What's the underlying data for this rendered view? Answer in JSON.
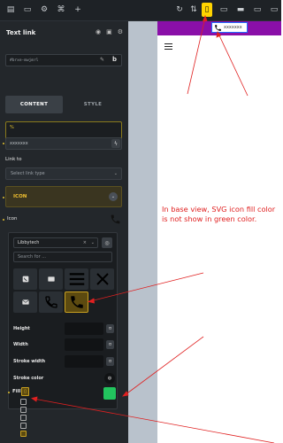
{
  "panel": {
    "title": "Text link",
    "id_field": "#brxe-mwjmrl",
    "tabs": [
      {
        "label": "CONTENT",
        "active": true
      },
      {
        "label": "STYLE",
        "active": false
      }
    ],
    "code_value": "%",
    "text_value": "xxxxxxx",
    "link_to_label": "Link to",
    "link_type_placeholder": "Select link type",
    "icon_section_label": "ICON",
    "icon_label": "Icon"
  },
  "picker": {
    "library": "Libbytech",
    "search_placeholder": "Search for ..."
  },
  "props": {
    "height_label": "Height",
    "width_label": "Width",
    "stroke_width_label": "Stroke width",
    "stroke_color_label": "Stroke color",
    "fill_label": "Fill",
    "fill_color": "#22c55e"
  },
  "canvas": {
    "link_text": "xxxxxxx",
    "bar_color": "#8a0fa8"
  },
  "annotation": {
    "text": "In base view, SVG icon fill color is not show in green color.",
    "color": "#e02020"
  }
}
